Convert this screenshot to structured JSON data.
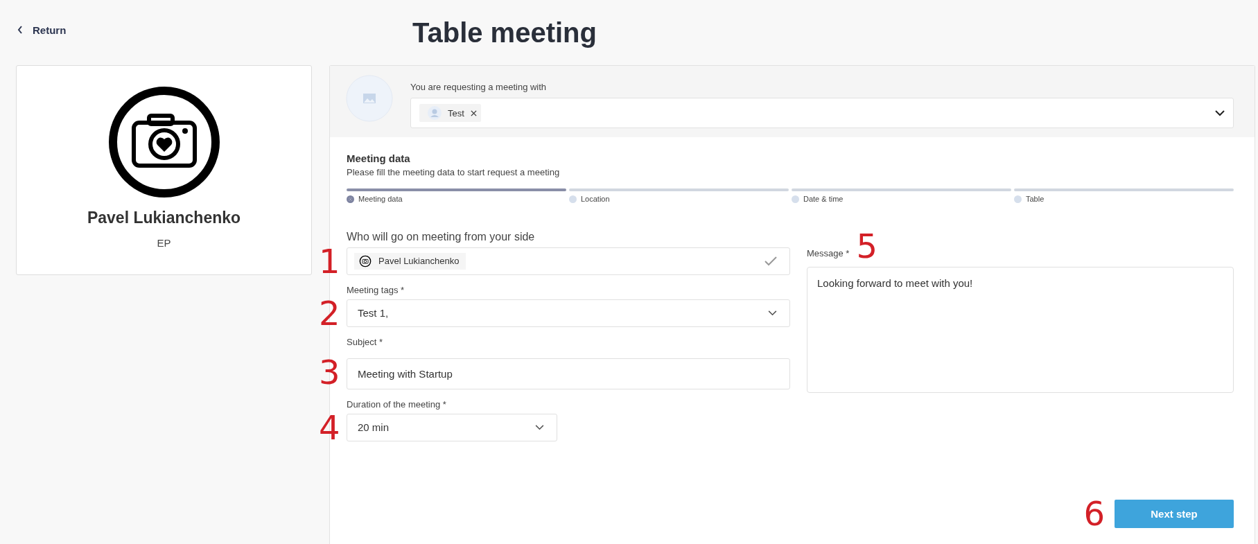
{
  "back_link": "Return",
  "title": "Table meeting",
  "profile": {
    "name": "Pavel Lukianchenko",
    "role": "EP"
  },
  "request": {
    "label": "You are requesting a meeting with",
    "chips": [
      {
        "label": "Test"
      }
    ]
  },
  "section": {
    "heading": "Meeting data",
    "subtitle": "Please fill the meeting data to start request a meeting"
  },
  "steps": [
    {
      "label": "Meeting data",
      "selected": true
    },
    {
      "label": "Location",
      "selected": false
    },
    {
      "label": "Date & time",
      "selected": false
    },
    {
      "label": "Table",
      "selected": false
    }
  ],
  "fields": [
    {
      "kind": "people",
      "label": "Who will go on meeting from your side",
      "value": "Pavel Lukianchenko",
      "callout": "1"
    },
    {
      "kind": "select",
      "label": "Meeting tags *",
      "value": "Test 1,",
      "callout": "2"
    },
    {
      "kind": "input",
      "label": "Subject *",
      "value": "Meeting with Startup",
      "callout": "3"
    },
    {
      "kind": "picker",
      "label": "Duration of the meeting *",
      "value": "20 min",
      "callout": "4"
    }
  ],
  "message": {
    "label": "Message *",
    "value": "Looking forward to meet with you!",
    "callout": "5"
  },
  "next_button": {
    "label": "Next step",
    "callout": "6"
  }
}
